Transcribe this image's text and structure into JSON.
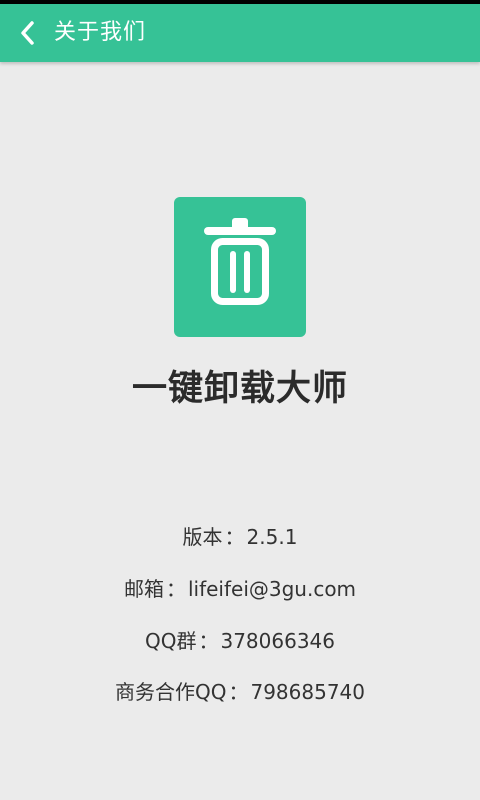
{
  "header": {
    "title": "关于我们",
    "back_icon": "chevron-left-icon",
    "background": "#36c296"
  },
  "app": {
    "name": "一键卸载大师",
    "icon": "trash-icon",
    "icon_color": "#36c296"
  },
  "info": {
    "version_label": "版本",
    "version_value": "2.5.1",
    "email_label": "邮箱",
    "email_value": "lifeifei@3gu.com",
    "qq_group_label": "QQ群",
    "qq_group_value": "378066346",
    "business_label": "商务合作QQ",
    "business_value": "798685740",
    "separator": "："
  }
}
